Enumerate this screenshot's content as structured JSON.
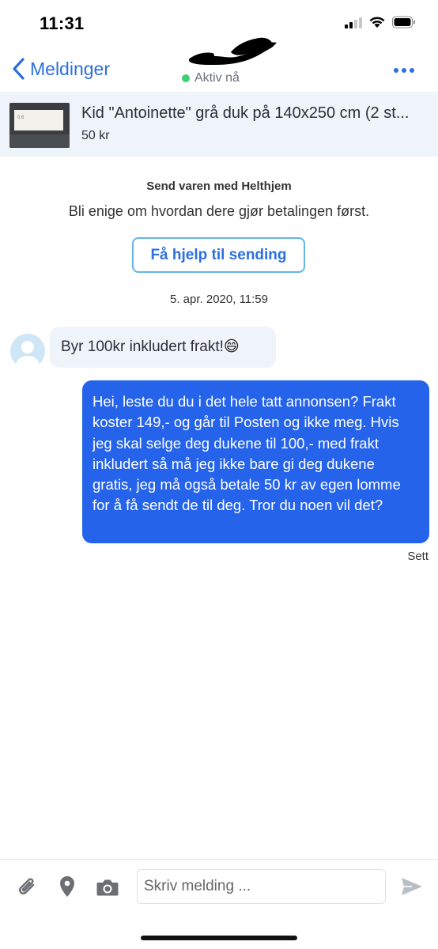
{
  "status_bar": {
    "time": "11:31",
    "icons": [
      "signal-icon",
      "wifi-icon",
      "battery-icon"
    ]
  },
  "header": {
    "back_label": "Meldinger",
    "presence_text": "Aktiv nå",
    "more_icon": "more-dots-icon"
  },
  "item": {
    "title": "Kid \"Antoinette\" grå duk på 140x250 cm (2 st...",
    "price": "50 kr"
  },
  "shipping": {
    "heading": "Send varen med Helthjem",
    "text": "Bli enige om hvordan dere gjør betalingen først.",
    "button_label": "Få hjelp til sending"
  },
  "conversation": {
    "timestamp": "5. apr. 2020, 11:59",
    "messages": [
      {
        "direction": "incoming",
        "text": "Byr 100kr inkludert frakt!",
        "emoji": "😄"
      },
      {
        "direction": "outgoing",
        "text": "Hei, leste du du i det hele tatt annonsen? Frakt koster 149,- og går til Posten og ikke meg. Hvis jeg skal selge deg dukene til 100,- med frakt inkludert så må jeg ikke bare gi deg dukene gratis, jeg må også betale 50 kr av egen lomme for å få sendt de til deg. Tror du noen vil det?"
      }
    ],
    "read_status": "Sett"
  },
  "composer": {
    "placeholder": "Skriv melding ...",
    "icons": [
      "paperclip-icon",
      "location-pin-icon",
      "camera-icon",
      "send-icon"
    ]
  },
  "colors": {
    "accent": "#2b6fe0",
    "outgoing_bubble": "#2563eb",
    "incoming_bubble": "#eff4fa",
    "presence": "#3ccf73"
  }
}
